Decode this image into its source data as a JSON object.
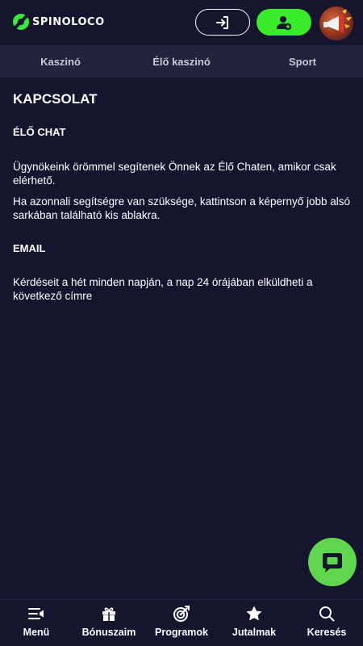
{
  "header": {
    "brand": "SPINOLOCO",
    "login_icon": "login-arrow-icon",
    "register_icon": "add-user-icon"
  },
  "nav": {
    "items": [
      {
        "label": "Kaszinó"
      },
      {
        "label": "Élő kaszinó"
      },
      {
        "label": "Sport"
      }
    ]
  },
  "main": {
    "title": "KAPCSOLAT",
    "live_chat": {
      "heading": "ÉLŐ CHAT",
      "p1": "Ügynökeink örömmel segítenek Önnek az Élő Chaten, amikor csak elérhető.",
      "p2": "Ha azonnali segítségre van szüksége, kattintson a képernyő jobb alsó sarkában található kis ablakra."
    },
    "email": {
      "heading": "EMAIL",
      "p1": "Kérdéseit a hét minden napján, a nap 24 órájában elküldheti a következő címre"
    }
  },
  "bottom_bar": {
    "tabs": [
      {
        "label": "Menü",
        "icon": "menu-icon"
      },
      {
        "label": "Bónuszaim",
        "icon": "gift-icon"
      },
      {
        "label": "Programok",
        "icon": "target-icon"
      },
      {
        "label": "Jutalmak",
        "icon": "star-icon"
      },
      {
        "label": "Keresés",
        "icon": "search-icon"
      }
    ]
  },
  "colors": {
    "background": "#151530",
    "nav_background": "#23233f",
    "accent_green": "#39ec29",
    "chat_green": "#5fd64e"
  }
}
